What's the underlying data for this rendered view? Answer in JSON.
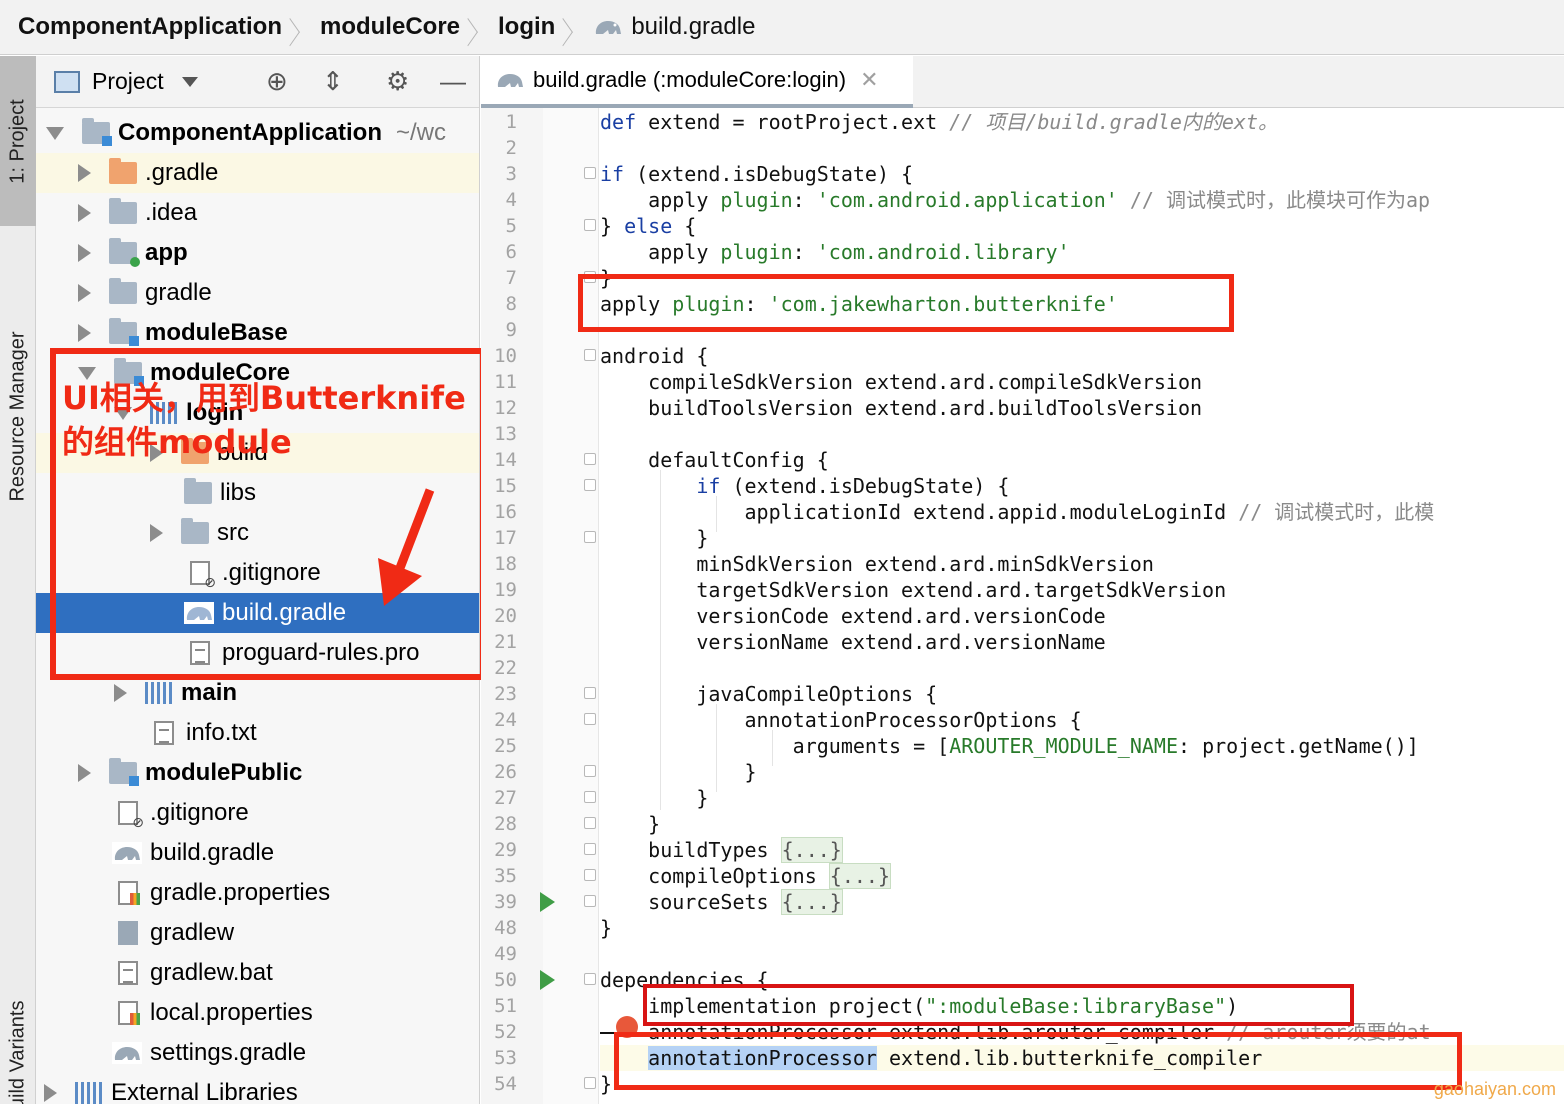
{
  "breadcrumb": {
    "items": [
      "ComponentApplication",
      "moduleCore",
      "login",
      "build.gradle"
    ]
  },
  "tool_strip": {
    "project_tab": "1: Project",
    "resource_tab": "Resource Manager",
    "build_variants_tab": "Build Variants"
  },
  "project_panel": {
    "view_selector": "Project",
    "tree": [
      {
        "label": "ComponentApplication",
        "suffix": "~/wc"
      },
      {
        "label": ".gradle"
      },
      {
        "label": ".idea"
      },
      {
        "label": "app"
      },
      {
        "label": "gradle"
      },
      {
        "label": "moduleBase"
      },
      {
        "label": "moduleCore"
      },
      {
        "label": "login"
      },
      {
        "label": "build"
      },
      {
        "label": "libs"
      },
      {
        "label": "src"
      },
      {
        "label": ".gitignore"
      },
      {
        "label": "build.gradle"
      },
      {
        "label": "proguard-rules.pro"
      },
      {
        "label": "main"
      },
      {
        "label": "info.txt"
      },
      {
        "label": "modulePublic"
      },
      {
        "label": ".gitignore"
      },
      {
        "label": "build.gradle"
      },
      {
        "label": "gradle.properties"
      },
      {
        "label": "gradlew"
      },
      {
        "label": "gradlew.bat"
      },
      {
        "label": "local.properties"
      },
      {
        "label": "settings.gradle"
      },
      {
        "label": "External Libraries"
      }
    ]
  },
  "annotation": {
    "line1": "UI相关，用到Butterknife",
    "line2": "的组件module"
  },
  "editor": {
    "tab_title": "build.gradle (:moduleCore:login)",
    "line_numbers": [
      "1",
      "2",
      "3",
      "4",
      "5",
      "6",
      "7",
      "8",
      "9",
      "10",
      "11",
      "12",
      "13",
      "14",
      "15",
      "16",
      "17",
      "18",
      "19",
      "20",
      "21",
      "22",
      "23",
      "24",
      "25",
      "26",
      "27",
      "28",
      "29",
      "35",
      "39",
      "48",
      "49",
      "50",
      "51",
      "52",
      "53",
      "54"
    ],
    "code": {
      "l1_a": "def",
      "l1_b": " extend = rootProject.ext ",
      "l1_c": "// 项目/build.gradle内的ext。",
      "l3_a": "if",
      "l3_b": " (extend.isDebugState) {",
      "l4_a": "    apply ",
      "l4_b": "plugin",
      "l4_c": ": ",
      "l4_d": "'com.android.application'",
      "l4_e": " // 调试模式时，此模块可作为ap",
      "l5_a": "} ",
      "l5_b": "else",
      "l5_c": " {",
      "l6_a": "    apply ",
      "l6_b": "plugin",
      "l6_c": ": ",
      "l6_d": "'com.android.library'",
      "l7": "}",
      "l8_a": "apply ",
      "l8_b": "plugin",
      "l8_c": ": ",
      "l8_d": "'com.jakewharton.butterknife'",
      "l10": "android {",
      "l11": "    compileSdkVersion extend.ard.compileSdkVersion",
      "l12": "    buildToolsVersion extend.ard.buildToolsVersion",
      "l14": "    defaultConfig {",
      "l15_a": "        ",
      "l15_b": "if",
      "l15_c": " (extend.isDebugState) {",
      "l16_a": "            applicationId extend.appid.moduleLoginId ",
      "l16_b": "// 调试模式时，此模",
      "l17": "        }",
      "l18": "        minSdkVersion extend.ard.minSdkVersion",
      "l19": "        targetSdkVersion extend.ard.targetSdkVersion",
      "l20": "        versionCode extend.ard.versionCode",
      "l21": "        versionName extend.ard.versionName",
      "l23": "        javaCompileOptions {",
      "l24": "            annotationProcessorOptions {",
      "l25_a": "                arguments = [",
      "l25_b": "AROUTER_MODULE_NAME",
      "l25_c": ": project.getName()]",
      "l26": "            }",
      "l27": "        }",
      "l28": "    }",
      "l29_a": "    buildTypes ",
      "l29_b": "{...}",
      "l35_a": "    compileOptions ",
      "l35_b": "{...}",
      "l39_a": "    sourceSets ",
      "l39_b": "{...}",
      "l48": "}",
      "l50": "dependencies {",
      "l51_a": "    implementation project(",
      "l51_b": "\":moduleBase:libraryBase\"",
      "l51_c": ")",
      "l52_a": "    annotationProcessor extend.lib.arouter_compiler ",
      "l52_b": "// arouter须要的at",
      "l53_a": "    ",
      "l53_b": "annotationProcessor",
      "l53_c": " extend.lib.butterknife_compiler",
      "l54": "}"
    }
  },
  "watermark": "gaohaiyan.com",
  "colors": {
    "selection": "#2f6fc0",
    "annotation_red": "#f02a15",
    "keyword": "#1a3fa3",
    "string": "#287a2a"
  }
}
